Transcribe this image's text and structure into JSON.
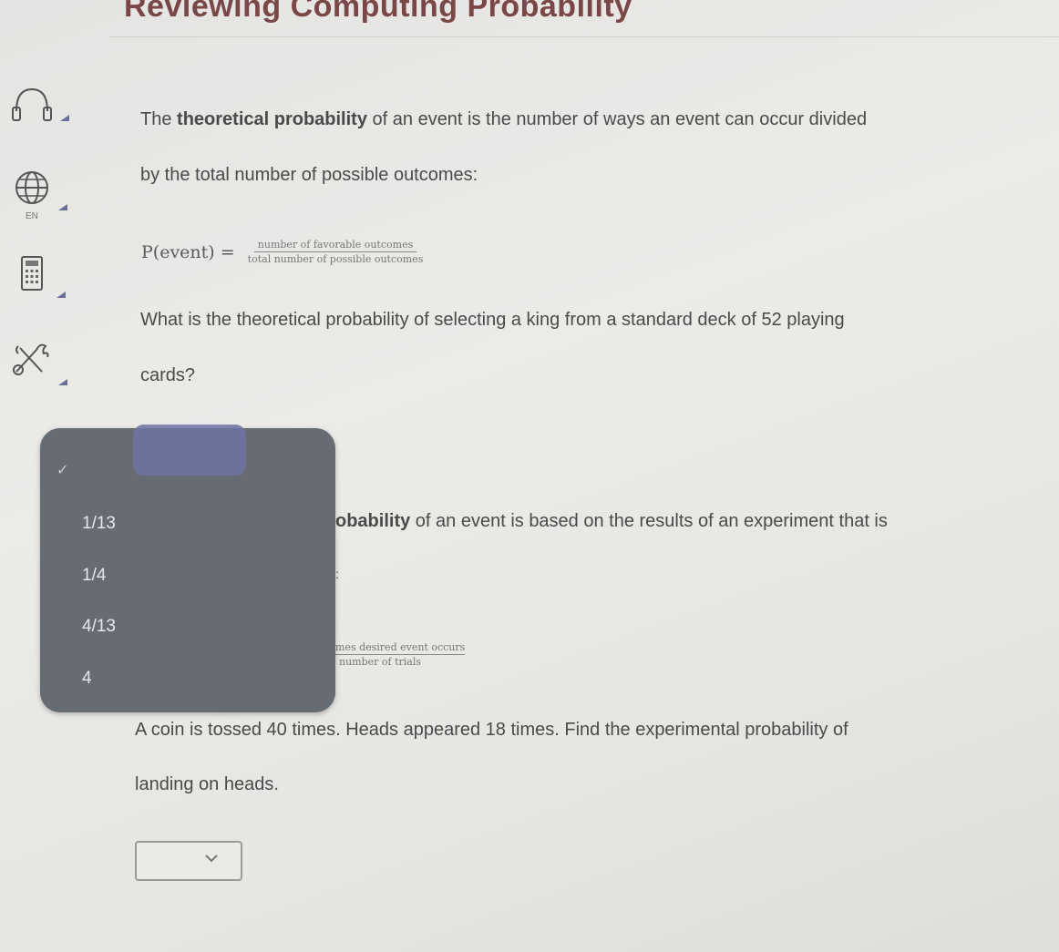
{
  "header": {
    "title": "Reviewing Computing Probability"
  },
  "sidebar": {
    "tools": [
      {
        "name": "headphones-icon"
      },
      {
        "name": "language-globe-icon",
        "label": "EN"
      },
      {
        "name": "calculator-icon"
      },
      {
        "name": "tools-icon"
      }
    ]
  },
  "theoretical": {
    "line1_pre": "The ",
    "line1_bold": "theoretical probability",
    "line1_post": " of an event is the number of ways an event can occur divided",
    "line2": "by the total number of possible outcomes:",
    "formula_lhs": "P(event) =",
    "formula_num": "number of favorable outcomes",
    "formula_den": "total number of possible outcomes"
  },
  "question1": {
    "line1": "What is the theoretical probability of selecting a king from a standard deck of 52 playing",
    "line2": "cards?"
  },
  "experimental": {
    "line1_bold": "obability",
    "line1_post": " of an event is based on the results of an experiment that is",
    "line2_frag": ":",
    "formula_num_frag": "mes desired event occurs",
    "formula_den_frag": "number of trials"
  },
  "dropdown_open": {
    "options": [
      "1/13",
      "1/4",
      "4/13",
      "4"
    ]
  },
  "question2": {
    "line1": "A coin is tossed 40 times. Heads appeared 18 times. Find the experimental probability of",
    "line2": "landing on heads."
  },
  "colors": {
    "title": "#7a4646",
    "dropdown_bg": "#676c73",
    "accent": "#6f73a4"
  }
}
